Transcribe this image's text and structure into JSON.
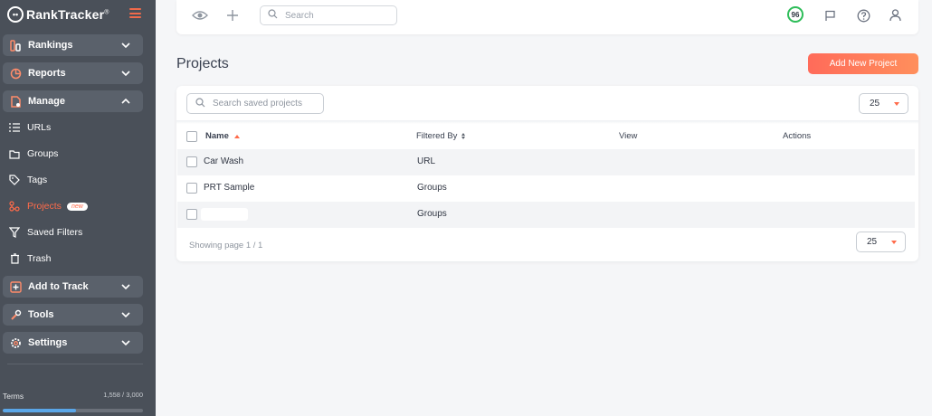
{
  "brand": {
    "name": "RankTracker",
    "trademark": "®"
  },
  "sidebar": {
    "groups": [
      {
        "label": "Rankings",
        "icon": "rankings-icon"
      },
      {
        "label": "Reports",
        "icon": "pie-chart-icon"
      },
      {
        "label": "Manage",
        "icon": "manage-icon"
      },
      {
        "label": "Add to Track",
        "icon": "plus-box-icon"
      },
      {
        "label": "Tools",
        "icon": "wrench-icon"
      },
      {
        "label": "Settings",
        "icon": "gear-icon"
      }
    ],
    "manage_items": [
      {
        "label": "URLs",
        "icon": "list-icon"
      },
      {
        "label": "Groups",
        "icon": "folder-icon"
      },
      {
        "label": "Tags",
        "icon": "tag-icon"
      },
      {
        "label": "Projects",
        "icon": "projects-icon",
        "badge": "new",
        "active": true
      },
      {
        "label": "Saved Filters",
        "icon": "filter-icon"
      },
      {
        "label": "Trash",
        "icon": "trash-icon"
      }
    ],
    "usage": {
      "label": "Terms",
      "count": "1,558 / 3,000",
      "fraction": 0.52
    }
  },
  "topbar": {
    "search_placeholder": "Search",
    "score": "96"
  },
  "page": {
    "title": "Projects",
    "add_button": "Add New Project"
  },
  "table": {
    "search_placeholder": "Search saved projects",
    "page_size": "25",
    "columns": {
      "name": "Name",
      "filtered_by": "Filtered By",
      "view": "View",
      "actions": "Actions"
    },
    "rows": [
      {
        "name": "Car Wash",
        "filtered_by": "URL",
        "view": "",
        "actions": ""
      },
      {
        "name": "PRT Sample",
        "filtered_by": "Groups",
        "view": "",
        "actions": ""
      },
      {
        "name": "",
        "filtered_by": "Groups",
        "view": "",
        "actions": "",
        "redacted": true
      }
    ],
    "showing": "Showing page 1 / 1",
    "footer_page_size": "25"
  },
  "colors": {
    "accent": "#ff6b4a",
    "sidebar": "#4a5059",
    "score_ring": "#2ebd59",
    "progress": "#5aa6e8"
  }
}
